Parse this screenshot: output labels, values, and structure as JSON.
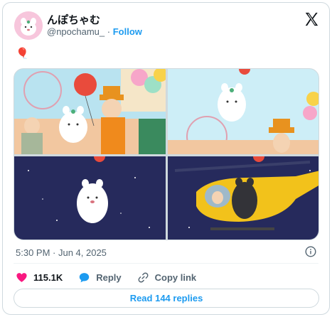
{
  "author": {
    "name": "んぽちゃむ",
    "handle": "@npochamu_",
    "separator": "·",
    "follow_label": "Follow"
  },
  "tweet": {
    "text": "🎈",
    "timestamp": "5:30 PM · Jun 4, 2025"
  },
  "media": {
    "images": [
      {
        "description": "character with balloon seller at amusement park"
      },
      {
        "description": "character floating away holding balloon"
      },
      {
        "description": "character floating in night sky"
      },
      {
        "description": "character outside helicopter at night"
      }
    ]
  },
  "actions": {
    "like_count": "115.1K",
    "reply_label": "Reply",
    "copy_link_label": "Copy link"
  },
  "read_replies_label": "Read 144 replies",
  "colors": {
    "accent": "#1d9bf0",
    "like": "#f91880",
    "secondary_text": "#536471",
    "border": "#cfd9de"
  },
  "icons": [
    "x-logo-icon",
    "info-icon",
    "heart-icon",
    "reply-icon",
    "link-icon"
  ]
}
